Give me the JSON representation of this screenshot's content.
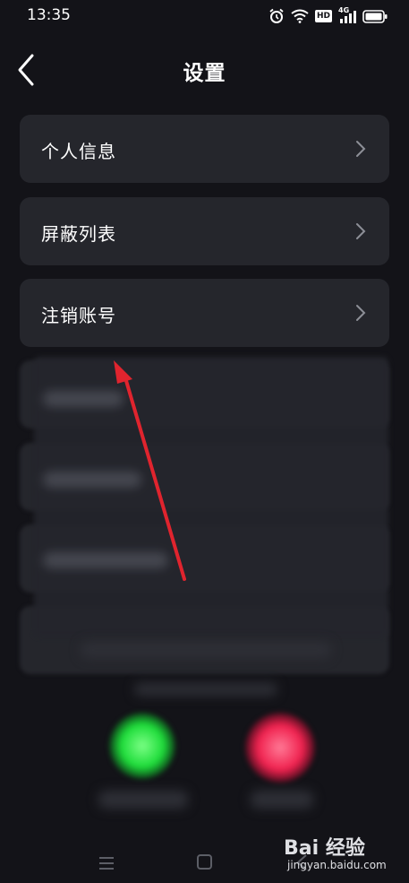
{
  "status_bar": {
    "time": "13:35",
    "hd": "HD",
    "network": "4G",
    "icons": [
      "alarm-icon",
      "wifi-icon",
      "hd-icon",
      "signal-icon",
      "battery-icon"
    ]
  },
  "header": {
    "title": "设置",
    "back_icon": "chevron-left-icon"
  },
  "menu": {
    "items": [
      {
        "label": "个人信息"
      },
      {
        "label": "屏蔽列表"
      },
      {
        "label": "注销账号"
      }
    ]
  },
  "annotation": {
    "color": "#e0242e"
  },
  "call_buttons": {
    "accept_color": "#1edc3a",
    "decline_color": "#f0224f"
  },
  "nav_bar": {
    "icons": [
      "menu-icon",
      "home-icon",
      "back-icon"
    ]
  },
  "watermark": {
    "logo": "Bai 经验",
    "url": "jingyan.baidu.com"
  }
}
